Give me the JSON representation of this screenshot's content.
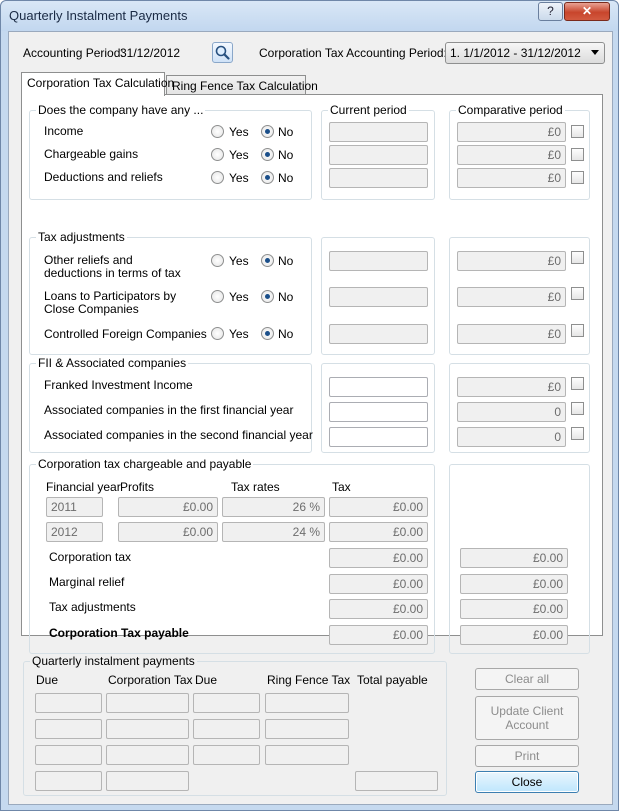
{
  "window": {
    "title": "Quarterly Instalment Payments",
    "help_label": "?",
    "close_label": "✕"
  },
  "header": {
    "accounting_period_label": "Accounting Period:",
    "accounting_period_value": "31/12/2012",
    "ct_period_label": "Corporation Tax Accounting Period:",
    "ct_period_value": "1. 1/1/2012 - 31/12/2012"
  },
  "tabs": [
    {
      "label": "Corporation Tax Calculation",
      "active": true
    },
    {
      "label": "Ring Fence Tax Calculation",
      "active": false
    }
  ],
  "columns": {
    "current": "Current period",
    "comparative": "Comparative period"
  },
  "radio_labels": {
    "yes": "Yes",
    "no": "No"
  },
  "section1": {
    "title": "Does the company have any ...",
    "rows": [
      {
        "label": "Income",
        "selected": "No",
        "current": "",
        "comparative": "£0"
      },
      {
        "label": "Chargeable gains",
        "selected": "No",
        "current": "",
        "comparative": "£0"
      },
      {
        "label": "Deductions and reliefs",
        "selected": "No",
        "current": "",
        "comparative": "£0"
      }
    ]
  },
  "section2": {
    "title": "Tax adjustments",
    "rows": [
      {
        "label1": "Other reliefs and",
        "label2": "deductions in terms of tax",
        "selected": "No",
        "current": "",
        "comparative": "£0"
      },
      {
        "label1": "Loans to Participators by",
        "label2": "Close Companies",
        "selected": "No",
        "current": "",
        "comparative": "£0"
      },
      {
        "label1": "Controlled Foreign Companies",
        "label2": "",
        "selected": "No",
        "current": "",
        "comparative": "£0"
      }
    ]
  },
  "section3": {
    "title": "FII & Associated companies",
    "rows": [
      {
        "label": "Franked Investment Income",
        "current": "",
        "comparative": "£0"
      },
      {
        "label": "Associated companies in the first financial year",
        "current": "",
        "comparative": "0"
      },
      {
        "label": "Associated companies in the second financial year",
        "current": "",
        "comparative": "0"
      }
    ]
  },
  "section4": {
    "title": "Corporation tax chargeable and payable",
    "headers": {
      "fy": "Financial year",
      "profits": "Profits",
      "rates": "Tax rates",
      "tax": "Tax"
    },
    "years": [
      {
        "fy": "2011",
        "profits": "£0.00",
        "rate": "26 %",
        "tax": "£0.00"
      },
      {
        "fy": "2012",
        "profits": "£0.00",
        "rate": "24 %",
        "tax": "£0.00"
      }
    ],
    "totals": [
      {
        "label": "Corporation tax",
        "current": "£0.00",
        "comparative": "£0.00",
        "bold": false
      },
      {
        "label": "Marginal relief",
        "current": "£0.00",
        "comparative": "£0.00",
        "bold": false
      },
      {
        "label": "Tax adjustments",
        "current": "£0.00",
        "comparative": "£0.00",
        "bold": false
      },
      {
        "label": "Corporation Tax payable",
        "current": "£0.00",
        "comparative": "£0.00",
        "bold": true
      }
    ]
  },
  "quarterly": {
    "title": "Quarterly instalment payments",
    "headers": {
      "due": "Due",
      "ct": "Corporation Tax",
      "due2": "Due",
      "rft": "Ring Fence Tax",
      "total": "Total payable"
    }
  },
  "buttons": {
    "clear_all": "Clear all",
    "update_line1": "Update Client",
    "update_line2": "Account",
    "print": "Print",
    "close": "Close"
  }
}
